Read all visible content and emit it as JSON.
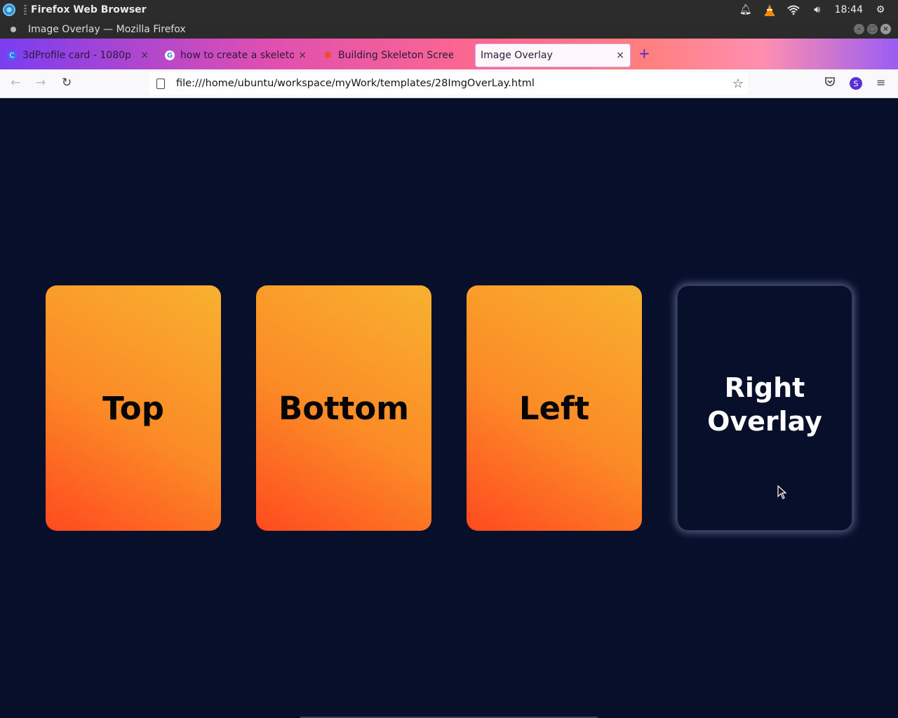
{
  "system_bar": {
    "app_name": "Firefox Web Browser",
    "clock": "18:44",
    "icons": [
      "notification-bell-icon",
      "vlc-icon",
      "wifi-icon",
      "volume-icon",
      "settings-gear-icon"
    ]
  },
  "window": {
    "title": "Image Overlay — Mozilla Firefox"
  },
  "tabs": [
    {
      "label": "3dProfile card - 1080p",
      "favicon": "C",
      "active": false
    },
    {
      "label": "how to create a skeleton",
      "favicon": "G",
      "active": false
    },
    {
      "label": "Building Skeleton Screen",
      "favicon": "✱",
      "active": false
    },
    {
      "label": "Image Overlay",
      "favicon": "",
      "active": true
    }
  ],
  "navbar": {
    "url": "file:///home/ubuntu/workspace/myWork/templates/28ImgOverLay.html",
    "avatar_letter": "S"
  },
  "cards": [
    {
      "label": "Top"
    },
    {
      "label": "Bottom"
    },
    {
      "label": "Left"
    },
    {
      "label_line1": "Right",
      "label_line2": "Overlay"
    }
  ]
}
